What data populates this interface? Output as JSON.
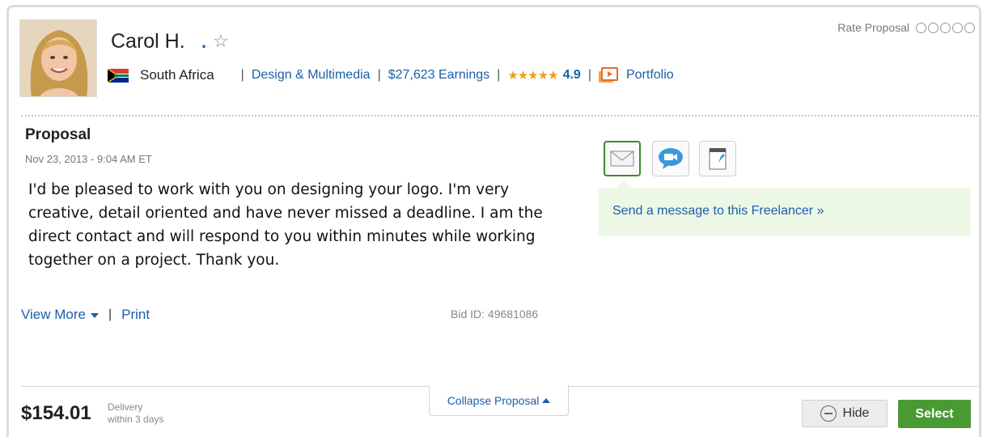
{
  "freelancer": {
    "name": "Carol H.",
    "verified_mark": ".",
    "country": "South Africa",
    "category": "Design & Multimedia",
    "earnings": "$27,623 Earnings",
    "rating_stars": "★★★★★",
    "rating": "4.9",
    "portfolio_label": "Portfolio"
  },
  "rate_proposal": {
    "label": "Rate Proposal",
    "value": 0,
    "max": 5
  },
  "proposal": {
    "title": "Proposal",
    "date": "Nov 23, 2013 - 9:04 AM ET",
    "body": "I'd be pleased to work with you on designing your logo. I'm very creative, detail oriented and have never missed a deadline. I am the direct contact and will respond to you within minutes while working together on a project. Thank you.",
    "view_more": "View More",
    "separator": "|",
    "print": "Print",
    "bid_id": "Bid ID: 49681086"
  },
  "actions": {
    "icons": [
      "envelope-icon",
      "video-chat-icon",
      "notepad-icon"
    ],
    "message_link": "Send a message to this Freelancer »"
  },
  "footer": {
    "collapse": "Collapse Proposal",
    "price": "$154.01",
    "delivery_label": "Delivery",
    "delivery_value": "within 3 days",
    "hide": "Hide",
    "select": "Select"
  },
  "colors": {
    "link": "#1a5fa8",
    "select_green": "#4a9a34",
    "active_border": "#3c8a2a",
    "star": "#e9a21a"
  }
}
